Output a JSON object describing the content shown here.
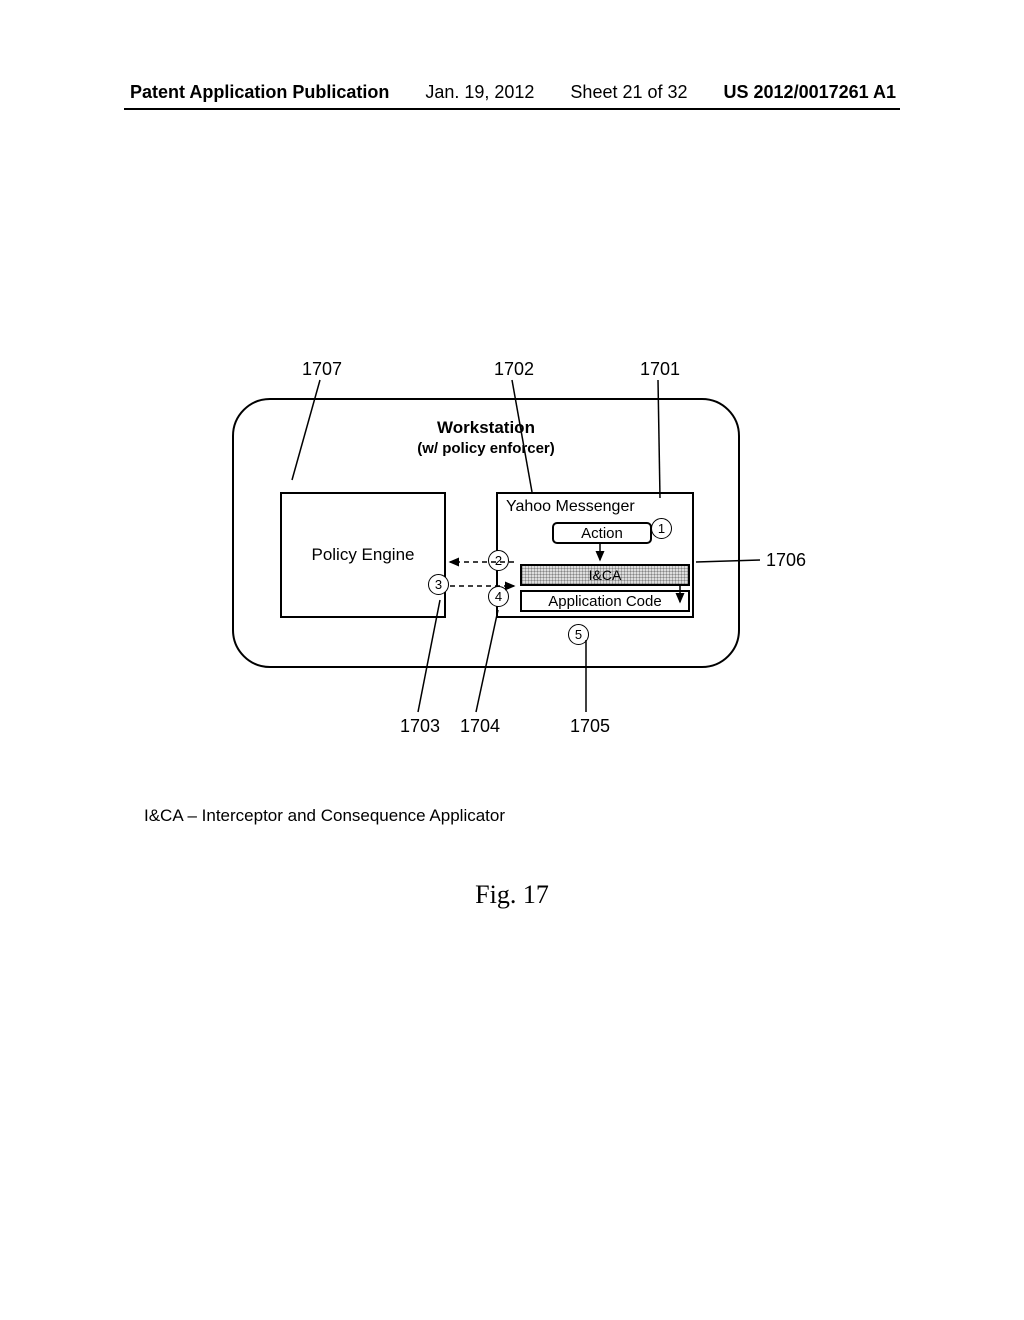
{
  "header": {
    "publication": "Patent Application Publication",
    "date": "Jan. 19, 2012",
    "sheet": "Sheet 21 of 32",
    "patno": "US 2012/0017261 A1"
  },
  "refs": {
    "r1707": "1707",
    "r1702": "1702",
    "r1701": "1701",
    "r1706": "1706",
    "r1703": "1703",
    "r1704": "1704",
    "r1705": "1705"
  },
  "workstation": {
    "title_bold": "Workstation",
    "subtitle": "(w/ policy enforcer)"
  },
  "policy_engine": {
    "label": "Policy Engine"
  },
  "messenger": {
    "title": "Yahoo Messenger",
    "action": "Action",
    "ica": "I&CA",
    "appcode": "Application Code"
  },
  "steps": {
    "s1": "1",
    "s2": "2",
    "s3": "3",
    "s4": "4",
    "s5": "5"
  },
  "legend": "I&CA – Interceptor  and Consequence Applicator",
  "figure": "Fig. 17"
}
